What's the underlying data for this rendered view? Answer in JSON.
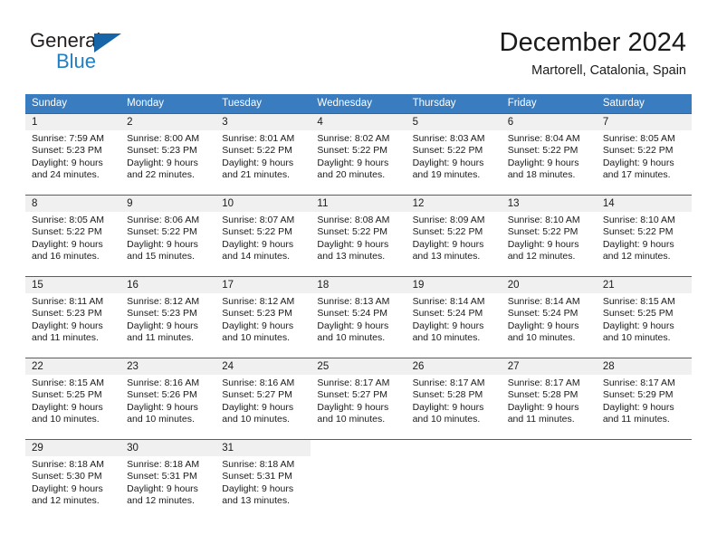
{
  "brand": {
    "name_top": "General",
    "name_bottom": "Blue",
    "triangle_color": "#1565a8",
    "blue_color": "#1f7fc4"
  },
  "header": {
    "title": "December 2024",
    "subtitle": "Martorell, Catalonia, Spain"
  },
  "calendar": {
    "header_bg": "#3a7cc0",
    "rule_color": "#1f6cb0",
    "daynum_band_bg": "#f0f0f0",
    "weekdays": [
      "Sunday",
      "Monday",
      "Tuesday",
      "Wednesday",
      "Thursday",
      "Friday",
      "Saturday"
    ],
    "weeks": [
      [
        {
          "day": "1",
          "lines": [
            "Sunrise: 7:59 AM",
            "Sunset: 5:23 PM",
            "Daylight: 9 hours",
            "and 24 minutes."
          ]
        },
        {
          "day": "2",
          "lines": [
            "Sunrise: 8:00 AM",
            "Sunset: 5:23 PM",
            "Daylight: 9 hours",
            "and 22 minutes."
          ]
        },
        {
          "day": "3",
          "lines": [
            "Sunrise: 8:01 AM",
            "Sunset: 5:22 PM",
            "Daylight: 9 hours",
            "and 21 minutes."
          ]
        },
        {
          "day": "4",
          "lines": [
            "Sunrise: 8:02 AM",
            "Sunset: 5:22 PM",
            "Daylight: 9 hours",
            "and 20 minutes."
          ]
        },
        {
          "day": "5",
          "lines": [
            "Sunrise: 8:03 AM",
            "Sunset: 5:22 PM",
            "Daylight: 9 hours",
            "and 19 minutes."
          ]
        },
        {
          "day": "6",
          "lines": [
            "Sunrise: 8:04 AM",
            "Sunset: 5:22 PM",
            "Daylight: 9 hours",
            "and 18 minutes."
          ]
        },
        {
          "day": "7",
          "lines": [
            "Sunrise: 8:05 AM",
            "Sunset: 5:22 PM",
            "Daylight: 9 hours",
            "and 17 minutes."
          ]
        }
      ],
      [
        {
          "day": "8",
          "lines": [
            "Sunrise: 8:05 AM",
            "Sunset: 5:22 PM",
            "Daylight: 9 hours",
            "and 16 minutes."
          ]
        },
        {
          "day": "9",
          "lines": [
            "Sunrise: 8:06 AM",
            "Sunset: 5:22 PM",
            "Daylight: 9 hours",
            "and 15 minutes."
          ]
        },
        {
          "day": "10",
          "lines": [
            "Sunrise: 8:07 AM",
            "Sunset: 5:22 PM",
            "Daylight: 9 hours",
            "and 14 minutes."
          ]
        },
        {
          "day": "11",
          "lines": [
            "Sunrise: 8:08 AM",
            "Sunset: 5:22 PM",
            "Daylight: 9 hours",
            "and 13 minutes."
          ]
        },
        {
          "day": "12",
          "lines": [
            "Sunrise: 8:09 AM",
            "Sunset: 5:22 PM",
            "Daylight: 9 hours",
            "and 13 minutes."
          ]
        },
        {
          "day": "13",
          "lines": [
            "Sunrise: 8:10 AM",
            "Sunset: 5:22 PM",
            "Daylight: 9 hours",
            "and 12 minutes."
          ]
        },
        {
          "day": "14",
          "lines": [
            "Sunrise: 8:10 AM",
            "Sunset: 5:22 PM",
            "Daylight: 9 hours",
            "and 12 minutes."
          ]
        }
      ],
      [
        {
          "day": "15",
          "lines": [
            "Sunrise: 8:11 AM",
            "Sunset: 5:23 PM",
            "Daylight: 9 hours",
            "and 11 minutes."
          ]
        },
        {
          "day": "16",
          "lines": [
            "Sunrise: 8:12 AM",
            "Sunset: 5:23 PM",
            "Daylight: 9 hours",
            "and 11 minutes."
          ]
        },
        {
          "day": "17",
          "lines": [
            "Sunrise: 8:12 AM",
            "Sunset: 5:23 PM",
            "Daylight: 9 hours",
            "and 10 minutes."
          ]
        },
        {
          "day": "18",
          "lines": [
            "Sunrise: 8:13 AM",
            "Sunset: 5:24 PM",
            "Daylight: 9 hours",
            "and 10 minutes."
          ]
        },
        {
          "day": "19",
          "lines": [
            "Sunrise: 8:14 AM",
            "Sunset: 5:24 PM",
            "Daylight: 9 hours",
            "and 10 minutes."
          ]
        },
        {
          "day": "20",
          "lines": [
            "Sunrise: 8:14 AM",
            "Sunset: 5:24 PM",
            "Daylight: 9 hours",
            "and 10 minutes."
          ]
        },
        {
          "day": "21",
          "lines": [
            "Sunrise: 8:15 AM",
            "Sunset: 5:25 PM",
            "Daylight: 9 hours",
            "and 10 minutes."
          ]
        }
      ],
      [
        {
          "day": "22",
          "lines": [
            "Sunrise: 8:15 AM",
            "Sunset: 5:25 PM",
            "Daylight: 9 hours",
            "and 10 minutes."
          ]
        },
        {
          "day": "23",
          "lines": [
            "Sunrise: 8:16 AM",
            "Sunset: 5:26 PM",
            "Daylight: 9 hours",
            "and 10 minutes."
          ]
        },
        {
          "day": "24",
          "lines": [
            "Sunrise: 8:16 AM",
            "Sunset: 5:27 PM",
            "Daylight: 9 hours",
            "and 10 minutes."
          ]
        },
        {
          "day": "25",
          "lines": [
            "Sunrise: 8:17 AM",
            "Sunset: 5:27 PM",
            "Daylight: 9 hours",
            "and 10 minutes."
          ]
        },
        {
          "day": "26",
          "lines": [
            "Sunrise: 8:17 AM",
            "Sunset: 5:28 PM",
            "Daylight: 9 hours",
            "and 10 minutes."
          ]
        },
        {
          "day": "27",
          "lines": [
            "Sunrise: 8:17 AM",
            "Sunset: 5:28 PM",
            "Daylight: 9 hours",
            "and 11 minutes."
          ]
        },
        {
          "day": "28",
          "lines": [
            "Sunrise: 8:17 AM",
            "Sunset: 5:29 PM",
            "Daylight: 9 hours",
            "and 11 minutes."
          ]
        }
      ],
      [
        {
          "day": "29",
          "lines": [
            "Sunrise: 8:18 AM",
            "Sunset: 5:30 PM",
            "Daylight: 9 hours",
            "and 12 minutes."
          ]
        },
        {
          "day": "30",
          "lines": [
            "Sunrise: 8:18 AM",
            "Sunset: 5:31 PM",
            "Daylight: 9 hours",
            "and 12 minutes."
          ]
        },
        {
          "day": "31",
          "lines": [
            "Sunrise: 8:18 AM",
            "Sunset: 5:31 PM",
            "Daylight: 9 hours",
            "and 13 minutes."
          ]
        },
        {
          "day": "",
          "lines": []
        },
        {
          "day": "",
          "lines": []
        },
        {
          "day": "",
          "lines": []
        },
        {
          "day": "",
          "lines": []
        }
      ]
    ]
  }
}
